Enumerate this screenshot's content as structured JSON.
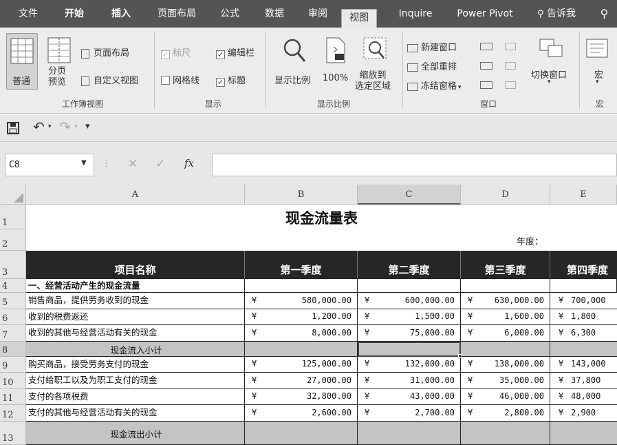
{
  "tabs": [
    "文件",
    "开始",
    "插入",
    "页面布局",
    "公式",
    "数据",
    "审阅",
    "视图",
    "Inquire",
    "Power Pivot",
    "告诉我"
  ],
  "active_tab": "视图",
  "ribbon": {
    "workbook_views": {
      "normal": "普通",
      "page_break_preview": "分页\n预览",
      "page_layout": "页面布局",
      "custom_views": "自定义视图",
      "group_label": "工作簿视图"
    },
    "show": {
      "ruler": "标尺",
      "formula_bar": "编辑栏",
      "gridlines": "网格线",
      "headings": "标题",
      "group_label": "显示"
    },
    "zoom": {
      "zoom": "显示比例",
      "zoom_100": "100%",
      "zoom_selection": "缩放到\n选定区域",
      "group_label": "显示比例"
    },
    "window": {
      "new_window": "新建窗口",
      "arrange_all": "全部重排",
      "freeze_panes": "冻结窗格",
      "switch_windows": "切换窗口",
      "group_label": "窗口"
    },
    "macros": {
      "macro": "宏",
      "group_label": "宏"
    }
  },
  "namebox": "C8",
  "formula_fx": "fx",
  "columns": [
    "A",
    "B",
    "C",
    "D",
    "E"
  ],
  "rows": [
    "1",
    "2",
    "3",
    "4",
    "5",
    "6",
    "7",
    "8",
    "9",
    "10",
    "11",
    "12",
    "13"
  ],
  "sheet": {
    "title": "现金流量表",
    "year_label": "年度：",
    "headers": [
      "项目名称",
      "第一季度",
      "第二季度",
      "第三季度",
      "第四季度"
    ],
    "section1": "一、经营活动产生的现金流量",
    "currency": "¥",
    "lines": [
      {
        "name": "销售商品，提供劳务收到的现金",
        "v": [
          "580,000.00",
          "600,000.00",
          "630,000.00",
          "700,000"
        ]
      },
      {
        "name": "收到的税费返还",
        "v": [
          "1,200.00",
          "1,500.00",
          "1,600.00",
          "1,800"
        ]
      },
      {
        "name": "收到的其他与经营活动有关的现金",
        "v": [
          "8,000.00",
          "75,000.00",
          "6,000.00",
          "6,300"
        ]
      },
      {
        "name": "现金流入小计",
        "v": [
          "",
          "",
          "",
          ""
        ]
      },
      {
        "name": "购买商品，接受劳务支付的现金",
        "v": [
          "125,000.00",
          "132,000.00",
          "138,000.00",
          "143,000"
        ]
      },
      {
        "name": "支付给职工以及为职工支付的现金",
        "v": [
          "27,000.00",
          "31,000.00",
          "35,000.00",
          "37,800"
        ]
      },
      {
        "name": "支付的各项税费",
        "v": [
          "32,800.00",
          "43,000.00",
          "46,000.00",
          "48,000"
        ]
      },
      {
        "name": "支付的其他与经营活动有关的现金",
        "v": [
          "2,600.00",
          "2,700.00",
          "2,800.00",
          "2,900"
        ]
      },
      {
        "name": "现金流出小计",
        "v": [
          "",
          "",
          "",
          ""
        ]
      }
    ]
  }
}
